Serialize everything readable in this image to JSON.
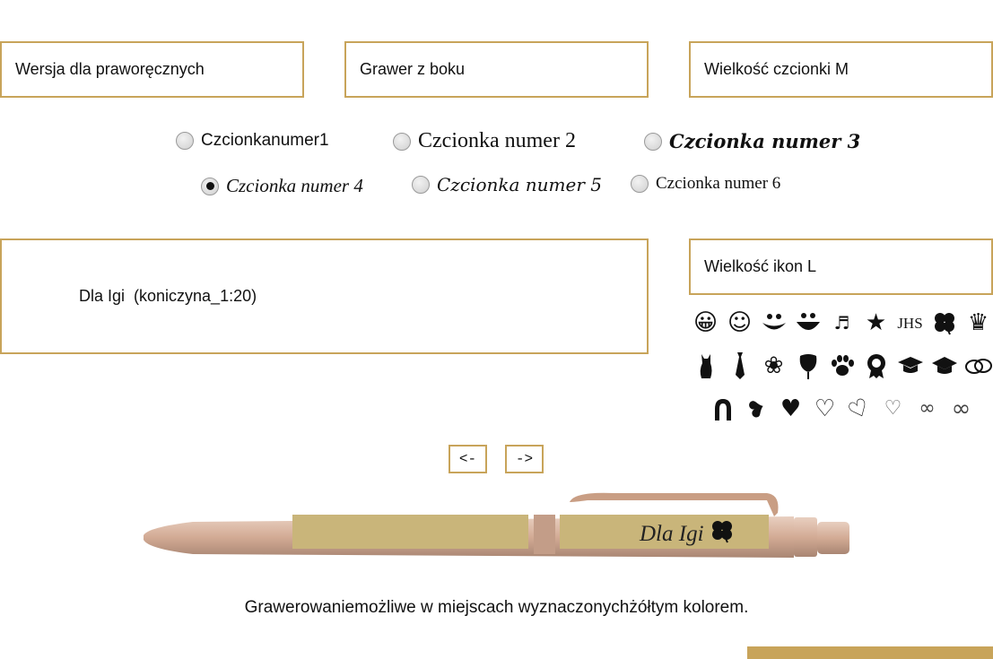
{
  "options": {
    "hand": "Wersja dla praworęcznych",
    "engrave_side": "Grawer z boku",
    "font_size": "Wielkość czcionki M",
    "icon_size": "Wielkość ikon L"
  },
  "fonts": [
    {
      "label": "Czcionkanumer1",
      "selected": false
    },
    {
      "label": "Czcionka numer 2",
      "selected": false
    },
    {
      "label": "Czcionka numer 3",
      "selected": false
    },
    {
      "label": "Czcionka numer 4",
      "selected": true
    },
    {
      "label": "Czcionka numer 5",
      "selected": false
    },
    {
      "label": "Czcionka numer 6",
      "selected": false
    }
  ],
  "engraving_text": "Dla Igi  (koniczyna_1:20)",
  "icons": [
    [
      "grinning-face",
      "smiling-face",
      "smile",
      "big-smile",
      "music-notes",
      "star",
      "jhs-symbol",
      "four-leaf-clover",
      "crown"
    ],
    [
      "cat",
      "necktie",
      "rose",
      "rose-bud",
      "paw-print",
      "award-rosette",
      "graduation-cap",
      "graduation-cap-solid",
      "wedding-rings"
    ],
    [
      "horseshoe",
      "heart-tilted",
      "heart-solid",
      "heart-outline",
      "heart-outline-slanted",
      "double-heart-outline",
      "infinity-small",
      "infinity"
    ]
  ],
  "nav": {
    "prev": "<-",
    "next": "->"
  },
  "preview": {
    "engraving": "Dla Igi"
  },
  "note": "Grawerowaniemożliwe w miejscach wyznaczonychżółtym kolorem.",
  "colors": {
    "accent": "#c8a45a",
    "pen_body": "#d3ab95",
    "engrave_area": "#c9b57a"
  }
}
